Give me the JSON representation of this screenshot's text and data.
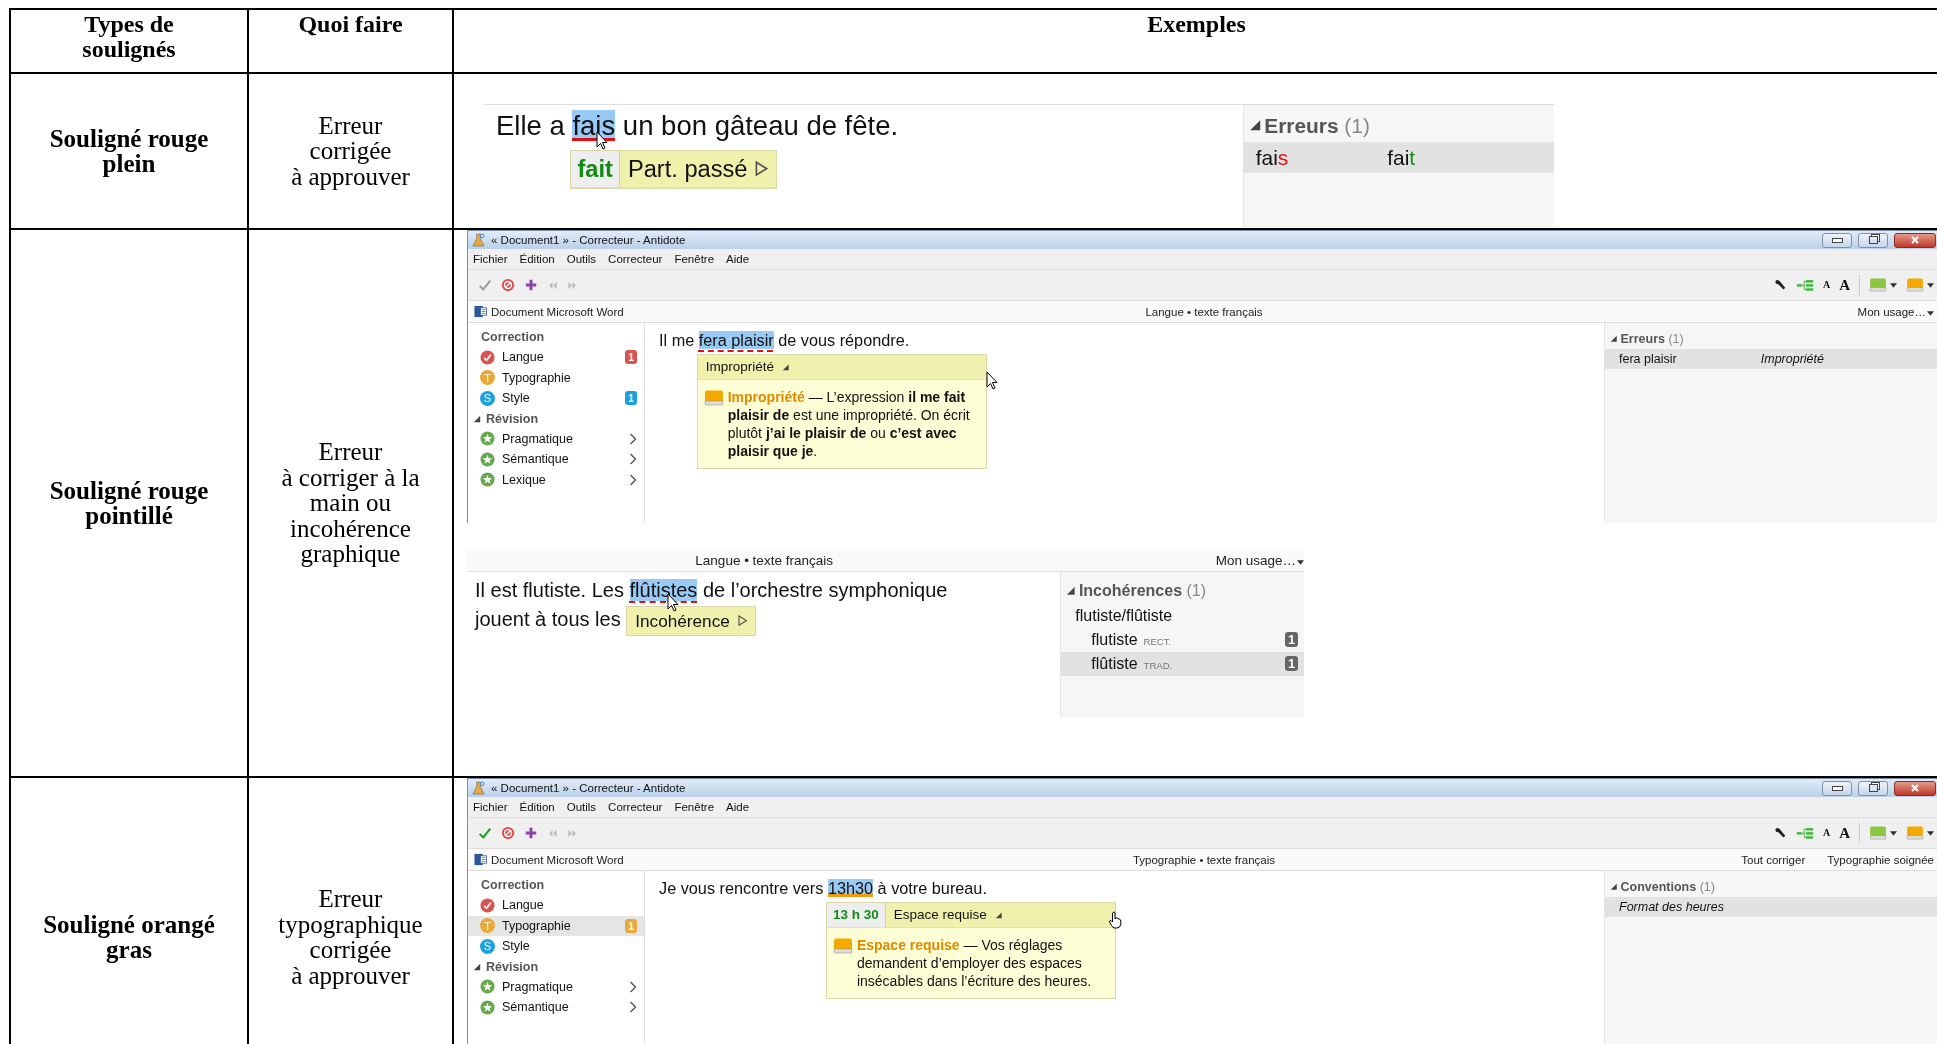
{
  "table": {
    "columns": [
      "Types de soulignés",
      "Quoi faire",
      "Exemples"
    ],
    "rows": [
      {
        "type": "Souligné rouge plein",
        "action": "Erreur\ncorrigée\nà approuver",
        "examples": [
          {
            "kind": "snippet",
            "lines": [
              [
                {
                  "kind": "plain",
                  "text": "Elle a "
                },
                {
                  "kind": "solid",
                  "text": "fais",
                  "selected": true,
                  "cursor": {
                    "kind": "arrow"
                  },
                  "popup": {
                    "kind": "below",
                    "suggestion": "fait",
                    "label": "Part. passé",
                    "expanded": false
                  }
                },
                {
                  "kind": "plain",
                  "text": " un bon gâteau de fête."
                }
              ]
            ],
            "panel": {
              "title": "Erreurs",
              "count": "(1)",
              "rows": [
                {
                  "kind": "correction",
                  "selected": true,
                  "original": [
                    "fai",
                    "s"
                  ],
                  "corrected": [
                    "fai",
                    "t"
                  ]
                }
              ]
            }
          }
        ]
      },
      {
        "type": "Souligné rouge pointillé",
        "action": "Erreur\nà corriger à la\nmain ou\nincohérence\ngraphique",
        "examples": [
          {
            "kind": "window",
            "title": "« Document1 » - Correcteur - Antidote",
            "menu": [
              "Fichier",
              "Édition",
              "Outils",
              "Correcteur",
              "Fenêtre",
              "Aide"
            ],
            "toolbar": {
              "accept_enabled": false,
              "font_buttons": [
                "A",
                "A"
              ]
            },
            "docbar": {
              "source": "Document Microsoft Word",
              "context": "Langue • texte français",
              "actions": [
                "Mon usage…"
              ]
            },
            "sidebar": [
              {
                "title": "Correction",
                "expanded": false,
                "items": [
                  {
                    "kind": "check",
                    "label": "Langue",
                    "color": "#d9534f",
                    "badge": "1",
                    "submenu": false,
                    "selected": false
                  },
                  {
                    "kind": "letter",
                    "label": "Typographie",
                    "letter": "T",
                    "color": "#e8a93a",
                    "submenu": false,
                    "selected": false
                  },
                  {
                    "kind": "letter",
                    "label": "Style",
                    "letter": "S",
                    "color": "#1ba1e2",
                    "badge": "1",
                    "submenu": false,
                    "selected": false
                  }
                ]
              },
              {
                "title": "Révision",
                "expanded": true,
                "items": [
                  {
                    "kind": "star",
                    "label": "Pragmatique",
                    "color": "#6aa84f",
                    "submenu": true,
                    "selected": false
                  },
                  {
                    "kind": "star",
                    "label": "Sémantique",
                    "color": "#6aa84f",
                    "submenu": true,
                    "selected": false
                  },
                  {
                    "kind": "star",
                    "label": "Lexique",
                    "color": "#6aa84f",
                    "submenu": true,
                    "selected": false
                  }
                ]
              }
            ],
            "lines": [
              [
                {
                  "kind": "plain",
                  "text": "Il me "
                },
                {
                  "kind": "dashed",
                  "text": "fera plaisir",
                  "selected": true,
                  "popup": {
                    "kind": "below",
                    "label": "Impropriété",
                    "expanded": true,
                    "cursor": {
                      "kind": "arrow"
                    },
                    "detail": {
                      "term": "Impropriété",
                      "text": " — L’expression **il me fait plaisir de** est une impropriété. On écrit plutôt **j’ai le plaisir de** ou **c’est avec plaisir que je**."
                    }
                  }
                },
                {
                  "kind": "plain",
                  "text": " de vous répondre."
                }
              ]
            ],
            "panel": {
              "title": "Erreurs",
              "count": "(1)",
              "rows": [
                {
                  "kind": "pair",
                  "selected": true,
                  "word": "fera plaisir",
                  "category": "Impropriété"
                }
              ]
            }
          },
          {
            "kind": "snippet",
            "docbar": {
              "context": "Langue • texte français",
              "actions": [
                "Mon usage…"
              ]
            },
            "lines": [
              [
                {
                  "kind": "plain",
                  "text": "Il est flutiste. Les "
                },
                {
                  "kind": "dashed",
                  "text": "flûtistes",
                  "selected": true,
                  "cursor": {
                    "kind": "arrow"
                  }
                },
                {
                  "kind": "plain",
                  "text": " de l’orchestre symphonique"
                }
              ],
              [
                {
                  "kind": "plain",
                  "text": "jouent à tous les "
                },
                {
                  "kind": "popup",
                  "popup": {
                    "kind": "inline",
                    "label": "Incohérence",
                    "expanded": false
                  }
                }
              ]
            ],
            "panel": {
              "title": "Incohérences",
              "count": "(1)",
              "rows": [
                {
                  "kind": "group",
                  "selected": false,
                  "text": "flutiste/flûtiste"
                },
                {
                  "kind": "variant",
                  "selected": false,
                  "word": "flutiste",
                  "tag": "RECT.",
                  "badge": "1"
                },
                {
                  "kind": "variant",
                  "selected": true,
                  "word": "flûtiste",
                  "tag": "TRAD.",
                  "badge": "1"
                }
              ]
            }
          }
        ]
      },
      {
        "type": "Souligné orangé gras",
        "action": "Erreur\ntypographique\ncorrigée\nà approuver",
        "examples": [
          {
            "kind": "window",
            "title": "« Document1 » - Correcteur - Antidote",
            "menu": [
              "Fichier",
              "Édition",
              "Outils",
              "Correcteur",
              "Fenêtre",
              "Aide"
            ],
            "toolbar": {
              "accept_enabled": true,
              "font_buttons": [
                "A",
                "A"
              ]
            },
            "docbar": {
              "source": "Document Microsoft Word",
              "context": "Typographie • texte français",
              "actions": [
                "Tout corriger",
                "Typographie soignée"
              ]
            },
            "sidebar": [
              {
                "title": "Correction",
                "expanded": false,
                "items": [
                  {
                    "kind": "check",
                    "label": "Langue",
                    "color": "#d9534f",
                    "submenu": false,
                    "selected": false
                  },
                  {
                    "kind": "letter",
                    "label": "Typographie",
                    "letter": "T",
                    "color": "#e8a93a",
                    "badge": "1",
                    "submenu": false,
                    "selected": true
                  },
                  {
                    "kind": "letter",
                    "label": "Style",
                    "letter": "S",
                    "color": "#1ba1e2",
                    "submenu": false,
                    "selected": false
                  }
                ]
              },
              {
                "title": "Révision",
                "expanded": true,
                "items": [
                  {
                    "kind": "star",
                    "label": "Pragmatique",
                    "color": "#6aa84f",
                    "submenu": true,
                    "selected": false
                  },
                  {
                    "kind": "star",
                    "label": "Sémantique",
                    "color": "#6aa84f",
                    "submenu": true,
                    "selected": false
                  }
                ]
              }
            ],
            "lines": [
              [
                {
                  "kind": "plain",
                  "text": "Je vous rencontre vers "
                },
                {
                  "kind": "bold",
                  "text": "13h30",
                  "selected": true,
                  "popup": {
                    "kind": "below",
                    "suggestion": "13 h 30",
                    "label": "Espace requise",
                    "expanded": true,
                    "cursor": {
                      "kind": "hand"
                    },
                    "detail": {
                      "term": "Espace requise",
                      "text": " — Vos réglages demandent d’employer des espaces insécables dans l’écriture des heures."
                    }
                  }
                },
                {
                  "kind": "plain",
                  "text": " à votre bureau."
                }
              ]
            ],
            "panel": {
              "title": "Conventions",
              "count": "(1)",
              "rows": [
                {
                  "kind": "label",
                  "selected": true,
                  "text": "Format des heures"
                }
              ]
            }
          }
        ]
      }
    ]
  }
}
